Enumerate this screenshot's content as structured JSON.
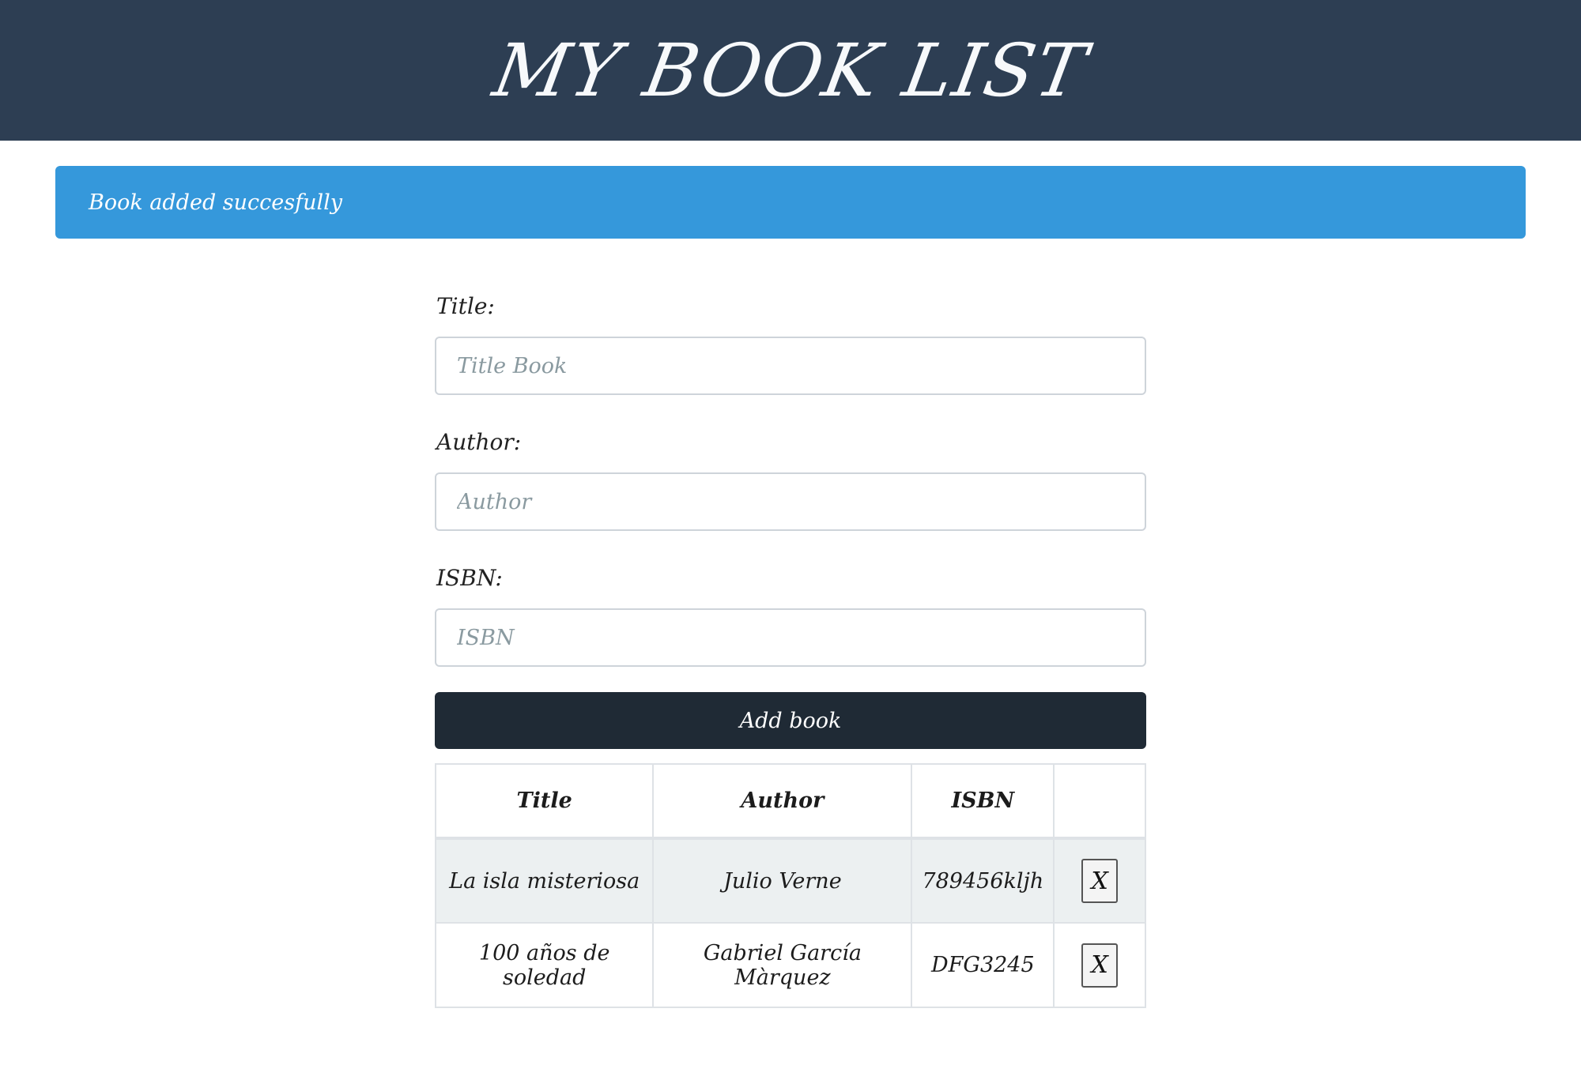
{
  "header": {
    "title": "MY BOOK LIST"
  },
  "alert": {
    "message": "Book added succesfully"
  },
  "form": {
    "title_label": "Title:",
    "title_placeholder": "Title Book",
    "title_value": "",
    "author_label": "Author:",
    "author_placeholder": "Author",
    "author_value": "",
    "isbn_label": "ISBN:",
    "isbn_placeholder": "ISBN",
    "isbn_value": "",
    "submit_label": "Add book"
  },
  "table": {
    "headers": [
      "Title",
      "Author",
      "ISBN",
      ""
    ],
    "rows": [
      {
        "title": "La isla misteriosa",
        "author": "Julio Verne",
        "isbn": "789456kljh",
        "delete_label": "X"
      },
      {
        "title": "100 años de soledad",
        "author": "Gabriel García Màrquez",
        "isbn": "DFG3245",
        "delete_label": "X"
      }
    ]
  },
  "colors": {
    "header_bg": "#2d3e53",
    "alert_bg": "#3598db",
    "button_bg": "#1f2a35",
    "striped_row_bg": "#ecf0f1"
  }
}
